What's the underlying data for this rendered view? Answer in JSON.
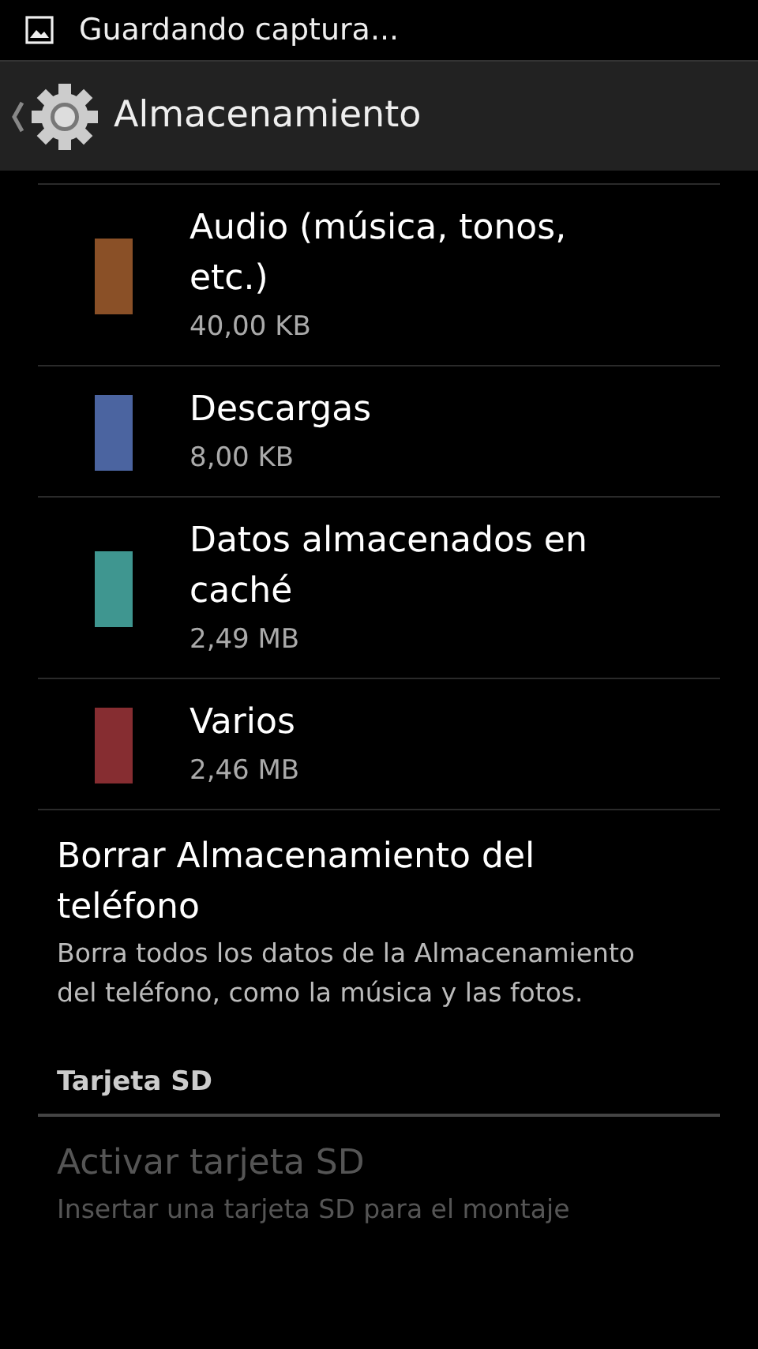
{
  "status_bar": {
    "notification": "Guardando captura..."
  },
  "action_bar": {
    "title": "Almacenamiento"
  },
  "storage_items": [
    {
      "title": "Audio (música, tonos, etc.)",
      "size": "40,00 KB",
      "color": "#8a5027"
    },
    {
      "title": "Descargas",
      "size": "8,00 KB",
      "color": "#4b64a0"
    },
    {
      "title": "Datos almacenados en caché",
      "size": "2,49 MB",
      "color": "#3f9690"
    },
    {
      "title": "Varios",
      "size": "2,46 MB",
      "color": "#862d31"
    }
  ],
  "preferences": [
    {
      "kind": "item",
      "title": "Borrar Almacenamiento del teléfono",
      "summary": "Borra todos los datos de la Almacenamiento del teléfono, como la música y las fotos.",
      "disabled": false
    },
    {
      "kind": "category",
      "title": "Tarjeta SD"
    },
    {
      "kind": "item",
      "title": "Activar tarjeta SD",
      "summary": "Insertar una tarjeta SD para el montaje",
      "disabled": true
    }
  ]
}
